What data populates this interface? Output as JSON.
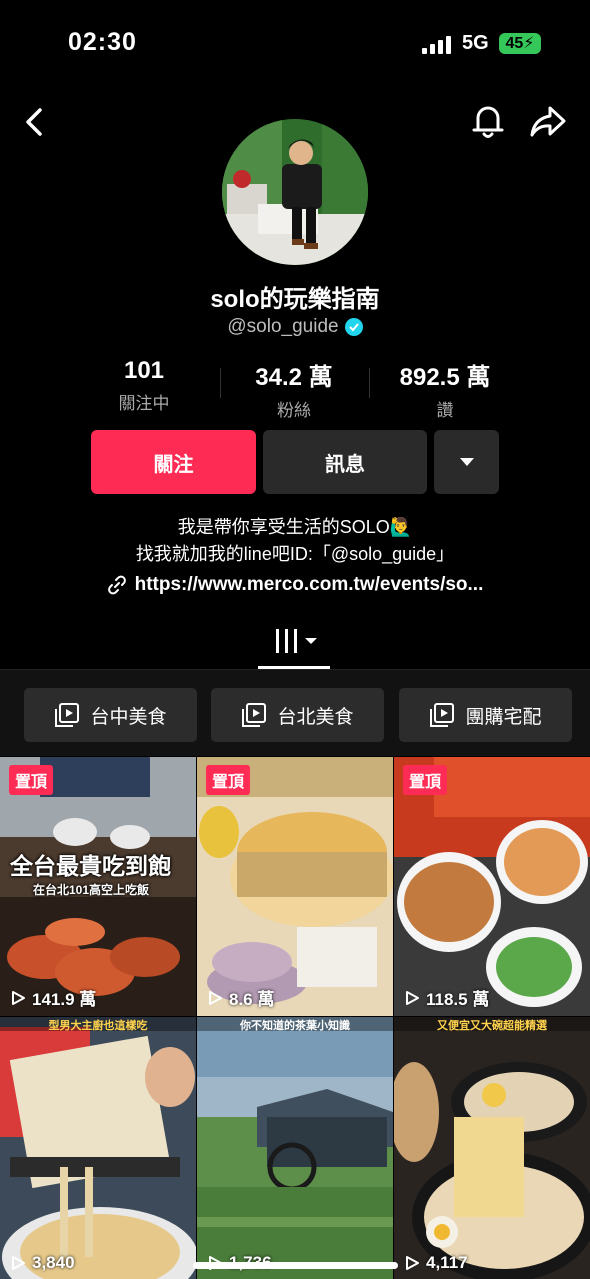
{
  "status_bar": {
    "time": "02:30",
    "network": "5G",
    "battery": "45"
  },
  "profile": {
    "display_name": "solo的玩樂指南",
    "handle": "@solo_guide",
    "stats": [
      {
        "value": "101",
        "label": "關注中"
      },
      {
        "value": "34.2 萬",
        "label": "粉絲"
      },
      {
        "value": "892.5 萬",
        "label": "讚"
      }
    ],
    "buttons": {
      "follow": "關注",
      "message": "訊息"
    },
    "bio_line1": "我是帶你享受生活的SOLO🙋‍♂️",
    "bio_line2": "找我就加我的line吧ID:「@solo_guide」",
    "link": "https://www.merco.com.tw/events/so..."
  },
  "playlists": [
    "台中美食",
    "台北美食",
    "團購宅配"
  ],
  "videos": [
    {
      "pinned_label": "置頂",
      "views": "141.9 萬",
      "caption1": "全台最貴吃到飽",
      "caption2": "在台北101高空上吃飯"
    },
    {
      "pinned_label": "置頂",
      "views": "8.6 萬"
    },
    {
      "pinned_label": "置頂",
      "views": "118.5 萬"
    },
    {
      "views": "3,840",
      "top_caption": "型男大主廚也這樣吃"
    },
    {
      "views": "1,736",
      "top_caption": "你不知道的茶葉小知識"
    },
    {
      "views": "4,117",
      "top_caption": "又便宜又大碗超能精選"
    }
  ],
  "colors": {
    "accent": "#fe2c55",
    "verified": "#20d5ec",
    "battery": "#35c759"
  }
}
